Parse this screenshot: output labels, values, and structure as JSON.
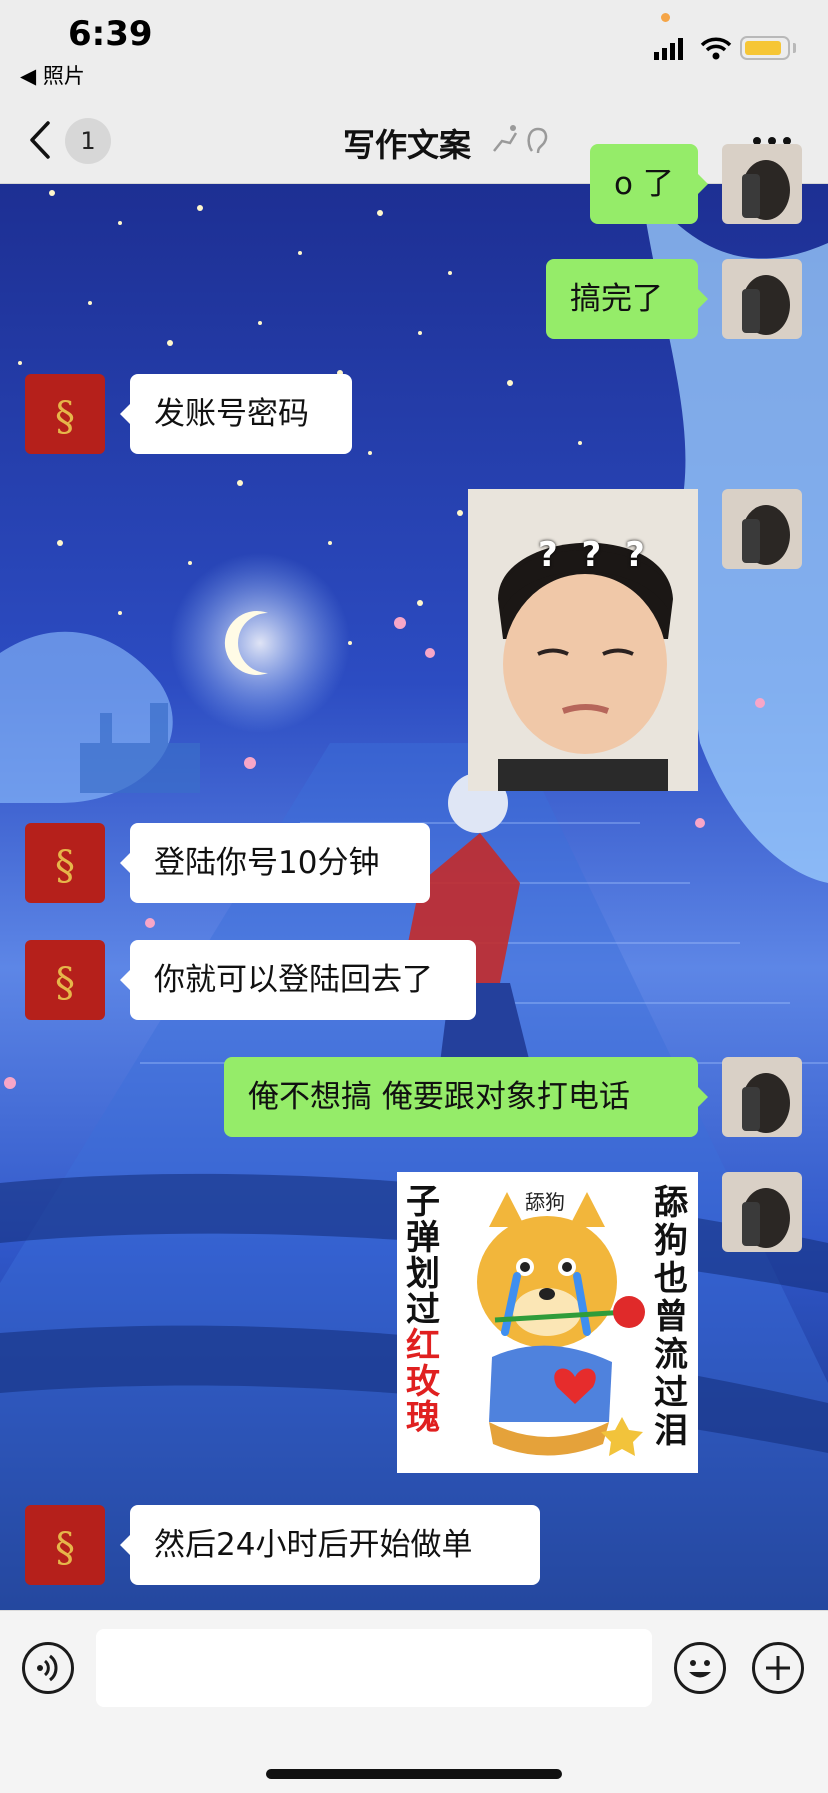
{
  "status": {
    "time": "6:39",
    "back_app": "◀ 照片"
  },
  "header": {
    "unread_count": "1",
    "title": "写作文案"
  },
  "messages": [
    {
      "side": "right",
      "type": "text",
      "text": "o 了"
    },
    {
      "side": "right",
      "type": "text",
      "text": "搞完了"
    },
    {
      "side": "left",
      "type": "text",
      "text": "发账号密码"
    },
    {
      "side": "right",
      "type": "image",
      "caption": "? ? ?"
    },
    {
      "side": "left",
      "type": "text",
      "text": "登陆你号10分钟"
    },
    {
      "side": "left",
      "type": "text",
      "text": "你就可以登陆回去了"
    },
    {
      "side": "right",
      "type": "text",
      "text": "俺不想搞 俺要跟对象打电话"
    },
    {
      "side": "right",
      "type": "sticker",
      "sticker_texts": {
        "left": [
          "子",
          "弹",
          "划",
          "过"
        ],
        "left_red": [
          "红",
          "玫",
          "瑰"
        ],
        "right": [
          "舔",
          "狗",
          "也",
          "曾",
          "流",
          "过",
          "泪"
        ],
        "top": "舔狗"
      }
    },
    {
      "side": "left",
      "type": "text",
      "text": "然后24小时后开始做单"
    }
  ],
  "input_bar": {
    "voice_icon": "voice-icon",
    "emoji_icon": "emoji-icon",
    "plus_icon": "plus-icon"
  },
  "colors": {
    "outgoing_bubble": "#95ec69",
    "incoming_bubble": "#ffffff",
    "header_bg": "#ededed",
    "battery": "#f6c636"
  }
}
